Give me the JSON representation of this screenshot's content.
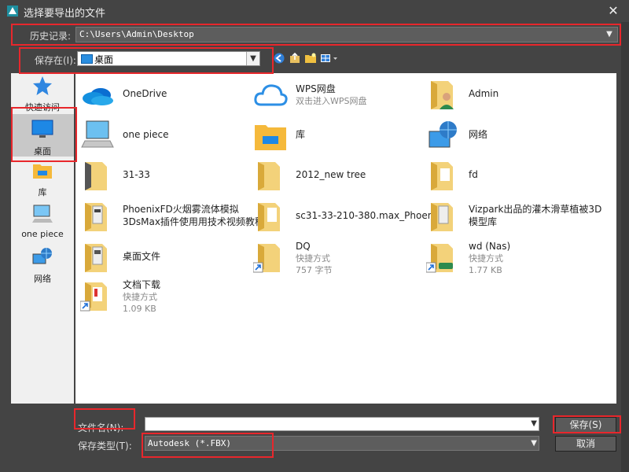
{
  "window": {
    "title": "选择要导出的文件",
    "close_glyph": "✕"
  },
  "history": {
    "label": "历史记录:",
    "value": "C:\\Users\\Admin\\Desktop"
  },
  "save_in": {
    "label": "保存在(I):",
    "value": "桌面"
  },
  "sidebar": {
    "items": [
      {
        "label": "快速访问",
        "icon": "star-icon"
      },
      {
        "label": "桌面",
        "icon": "desktop-icon",
        "selected": true
      },
      {
        "label": "库",
        "icon": "library-icon"
      },
      {
        "label": "one piece",
        "icon": "computer-icon"
      },
      {
        "label": "网络",
        "icon": "network-icon"
      }
    ]
  },
  "files": [
    {
      "name": "OneDrive",
      "icon": "onedrive-icon"
    },
    {
      "name": "WPS网盘",
      "sub": "双击进入WPS网盘",
      "icon": "cloud-icon"
    },
    {
      "name": "Admin",
      "icon": "user-folder-icon"
    },
    {
      "name": "one piece",
      "icon": "computer-icon"
    },
    {
      "name": "库",
      "icon": "library-icon"
    },
    {
      "name": "网络",
      "icon": "network-icon"
    },
    {
      "name": "31-33",
      "icon": "folder-icon"
    },
    {
      "name": "2012_new tree",
      "icon": "folder-icon"
    },
    {
      "name": "fd",
      "icon": "folder-icon"
    },
    {
      "name": "PhoenixFD火烟雾流体模拟",
      "name2": "3DsMax插件使用用技术视频教程",
      "icon": "folder-icon"
    },
    {
      "name": "sc31-33-210-380.max_Phoeni...",
      "icon": "folder-icon"
    },
    {
      "name": "Vizpark出品的灌木滑草植被3D",
      "name2": "模型库",
      "icon": "folder-icon"
    },
    {
      "name": "桌面文件",
      "icon": "folder-icon"
    },
    {
      "name": "DQ",
      "sub": "快捷方式",
      "sub2": "757 字节",
      "icon": "shortcut-folder-icon"
    },
    {
      "name": "wd (Nas)",
      "sub": "快捷方式",
      "sub2": "1.77 KB",
      "icon": "shortcut-folder-icon"
    },
    {
      "name": "文档下载",
      "sub": "快捷方式",
      "sub2": "1.09 KB",
      "icon": "shortcut-folder-icon"
    }
  ],
  "filename": {
    "label": "文件名(N):",
    "value": ""
  },
  "filetype": {
    "label": "保存类型(T):",
    "value": "Autodesk (*.FBX)"
  },
  "buttons": {
    "save": "保存(S)",
    "cancel": "取消"
  }
}
